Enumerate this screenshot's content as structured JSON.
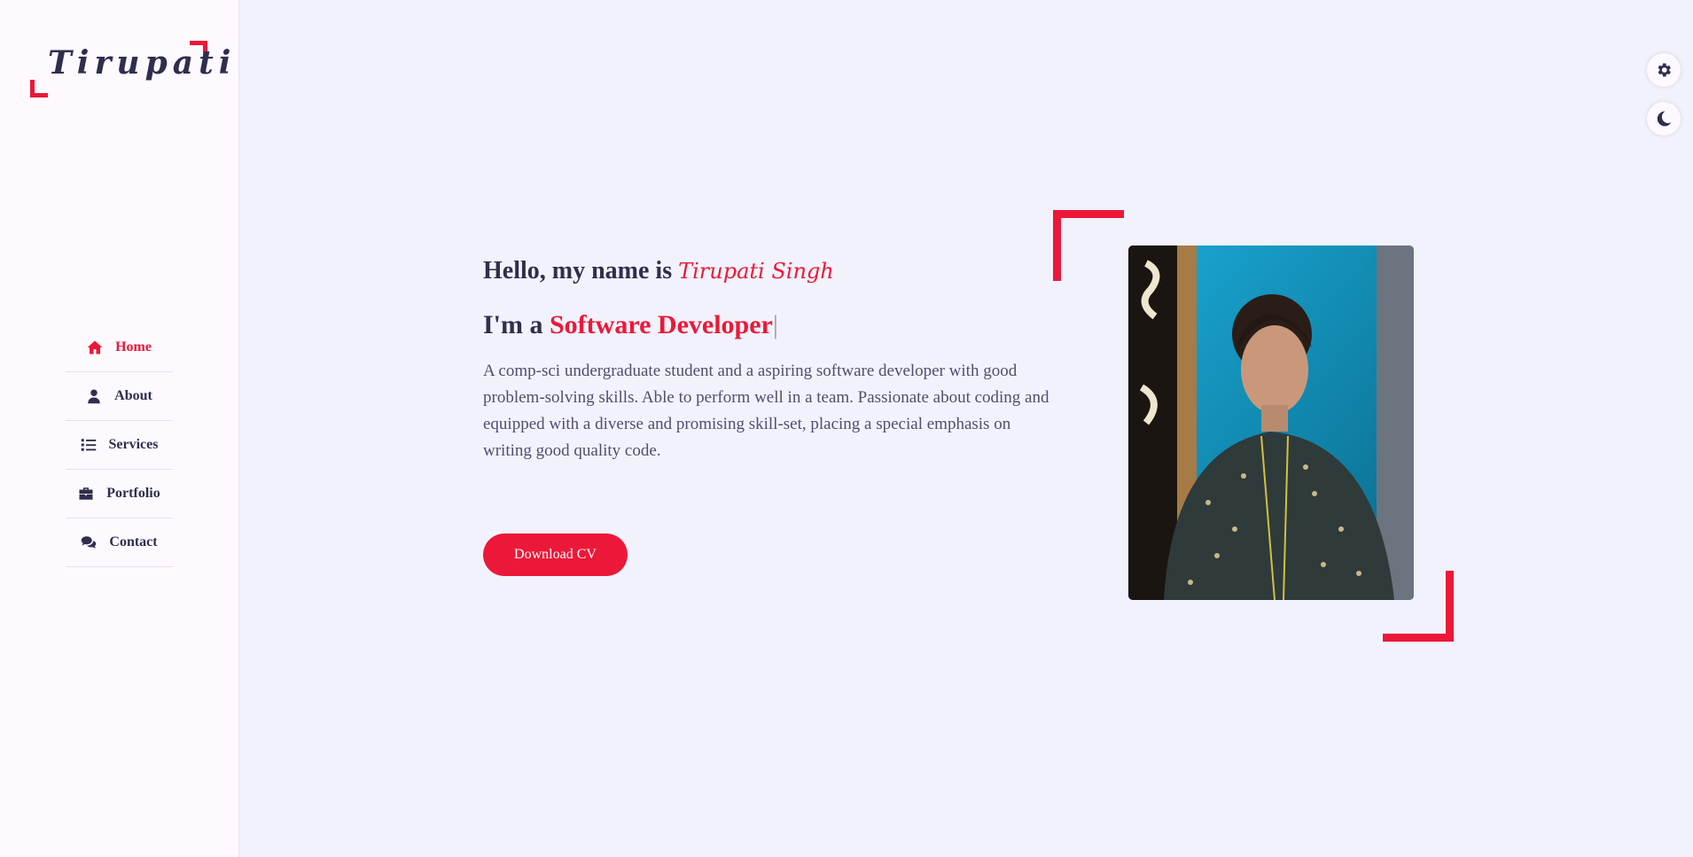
{
  "sidebar": {
    "logo": "Tirupati",
    "items": [
      {
        "label": "Home",
        "icon": "home-icon",
        "active": true
      },
      {
        "label": "About",
        "icon": "user-icon",
        "active": false
      },
      {
        "label": "Services",
        "icon": "list-icon",
        "active": false
      },
      {
        "label": "Portfolio",
        "icon": "briefcase-icon",
        "active": false
      },
      {
        "label": "Contact",
        "icon": "comments-icon",
        "active": false
      }
    ]
  },
  "style_switcher": {
    "settings_icon": "gear-icon",
    "theme_icon": "moon-icon"
  },
  "home": {
    "greeting": "Hello, my name is",
    "name": "Tirupati Singh",
    "role_prefix": "I'm a",
    "role": "Software Developer",
    "cursor": "|",
    "description": "A comp-sci undergraduate student and a aspiring software developer with good problem-solving skills. Able to perform well in a team. Passionate about coding and equipped with a diverse and promising skill-set, placing a special emphasis on writing good quality code.",
    "cv_button": "Download CV"
  },
  "colors": {
    "accent": "#ec1839",
    "text": "#302e4d",
    "body_bg": "#f2f2fc",
    "sidebar_bg": "#fdf9ff"
  }
}
